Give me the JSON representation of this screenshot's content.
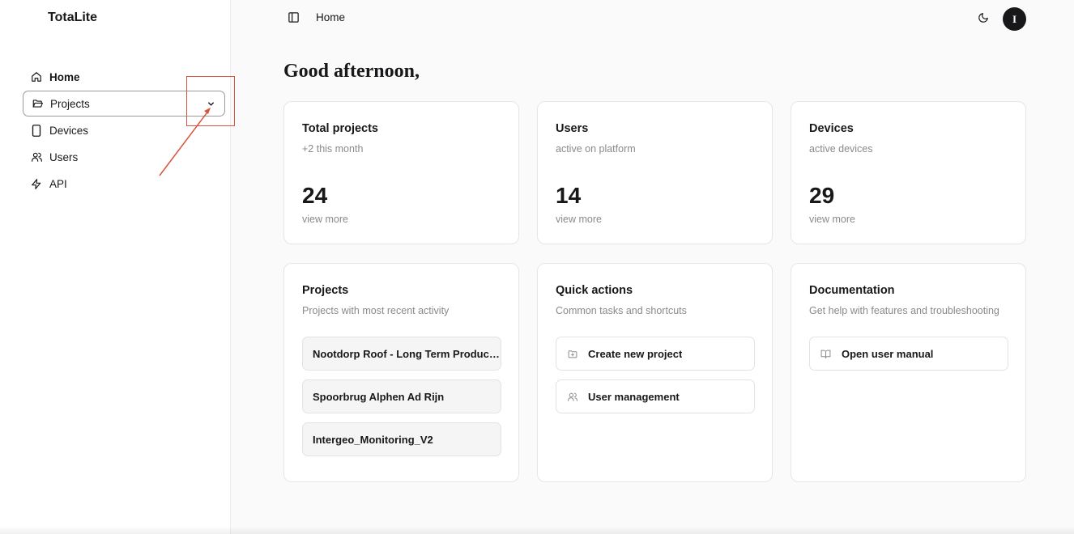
{
  "app": {
    "brand": "TotaLite"
  },
  "sidebar": {
    "items": [
      {
        "label": "Home",
        "icon": "home-icon"
      },
      {
        "label": "Projects",
        "icon": "folder-open-icon"
      },
      {
        "label": "Devices",
        "icon": "smartphone-icon"
      },
      {
        "label": "Users",
        "icon": "users-icon"
      },
      {
        "label": "API",
        "icon": "zap-icon"
      }
    ]
  },
  "topbar": {
    "breadcrumb": "Home",
    "avatar_initial": "I"
  },
  "greeting": "Good afternoon,",
  "stats": [
    {
      "title": "Total projects",
      "subtitle": "+2 this month",
      "value": "24",
      "link": "view more"
    },
    {
      "title": "Users",
      "subtitle": "active on platform",
      "value": "14",
      "link": "view more"
    },
    {
      "title": "Devices",
      "subtitle": "active devices",
      "value": "29",
      "link": "view more"
    }
  ],
  "projects_card": {
    "title": "Projects",
    "subtitle": "Projects with most recent activity",
    "items": [
      "Nootdorp Roof - Long Term Production",
      "Spoorbrug Alphen Ad Rijn",
      "Intergeo_Monitoring_V2"
    ]
  },
  "quick_actions": {
    "title": "Quick actions",
    "subtitle": "Common tasks and shortcuts",
    "items": [
      {
        "label": "Create new project",
        "icon": "folder-plus-icon"
      },
      {
        "label": "User management",
        "icon": "users-icon"
      }
    ]
  },
  "documentation": {
    "title": "Documentation",
    "subtitle": "Get help with features and troubleshooting",
    "items": [
      {
        "label": "Open user manual",
        "icon": "book-open-icon"
      }
    ]
  },
  "colors": {
    "annotation": "#d9533f",
    "text": "#18181b",
    "muted": "#8a8a8a"
  }
}
